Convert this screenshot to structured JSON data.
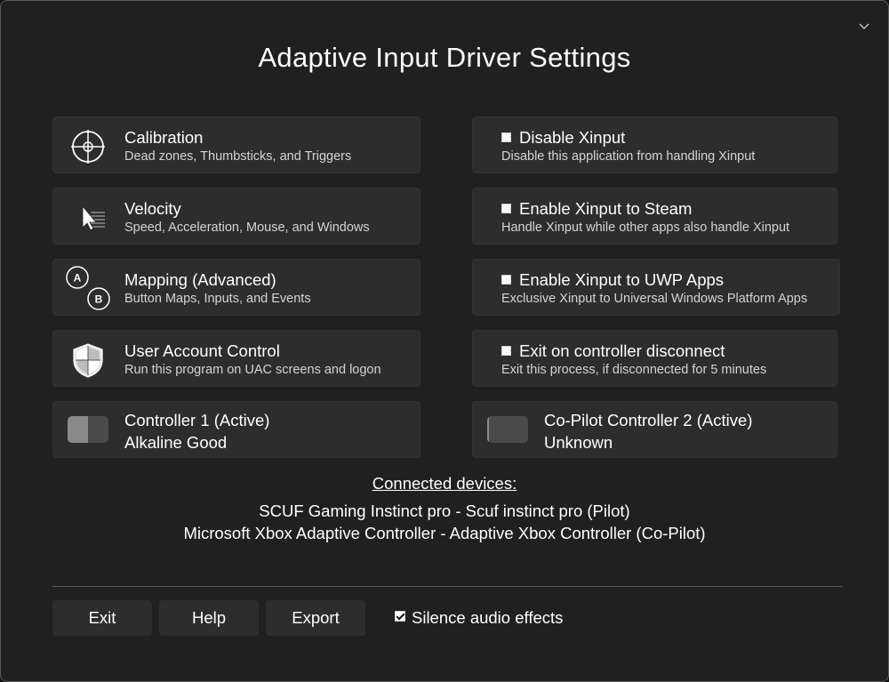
{
  "window": {
    "title": "Adaptive Input Driver Settings",
    "collapse_icon": "chevron-down-icon"
  },
  "left_cards": [
    {
      "heading": "Calibration",
      "description": "Dead zones, Thumbsticks, and Triggers",
      "icon": "crosshair-icon"
    },
    {
      "heading": "Velocity",
      "description": "Speed, Acceleration, Mouse, and Windows",
      "icon": "cursor-speed-icon"
    },
    {
      "heading": "Mapping (Advanced)",
      "description": "Button Maps, Inputs, and Events",
      "icon": "ab-buttons-icon",
      "icon_text": [
        "A",
        "B"
      ]
    },
    {
      "heading": "User Account Control",
      "description": "Run this program on UAC screens and logon",
      "icon": "shield-icon"
    }
  ],
  "right_options": [
    {
      "label": "Disable Xinput",
      "description": "Disable this application from handling Xinput",
      "checked": false
    },
    {
      "label": "Enable Xinput to Steam",
      "description": "Handle Xinput while other apps also handle Xinput",
      "checked": false
    },
    {
      "label": "Enable Xinput to UWP Apps",
      "description": "Exclusive Xinput to Universal Windows Platform Apps",
      "checked": false
    },
    {
      "label": "Exit on controller disconnect",
      "description": "Exit this process, if disconnected for 5 minutes",
      "checked": false
    }
  ],
  "controllers": [
    {
      "name": "Controller 1 (Active)",
      "status": "Alkaline Good",
      "battery_level": 0.5
    },
    {
      "name": "Co-Pilot Controller 2 (Active)",
      "status": "Unknown",
      "battery_level": 0.05
    }
  ],
  "connected": {
    "label": "Connected devices:",
    "devices": [
      "SCUF Gaming Instinct pro - Scuf instinct pro (Pilot)",
      "Microsoft Xbox Adaptive Controller - Adaptive Xbox Controller (Co-Pilot)"
    ]
  },
  "footer": {
    "exit_label": "Exit",
    "help_label": "Help",
    "export_label": "Export",
    "silence_label": "Silence audio effects",
    "silence_checked": true
  },
  "colors": {
    "background": "#202020",
    "card": "#2d2d2d",
    "text": "#ffffff",
    "subtext": "#d4d4d4"
  }
}
